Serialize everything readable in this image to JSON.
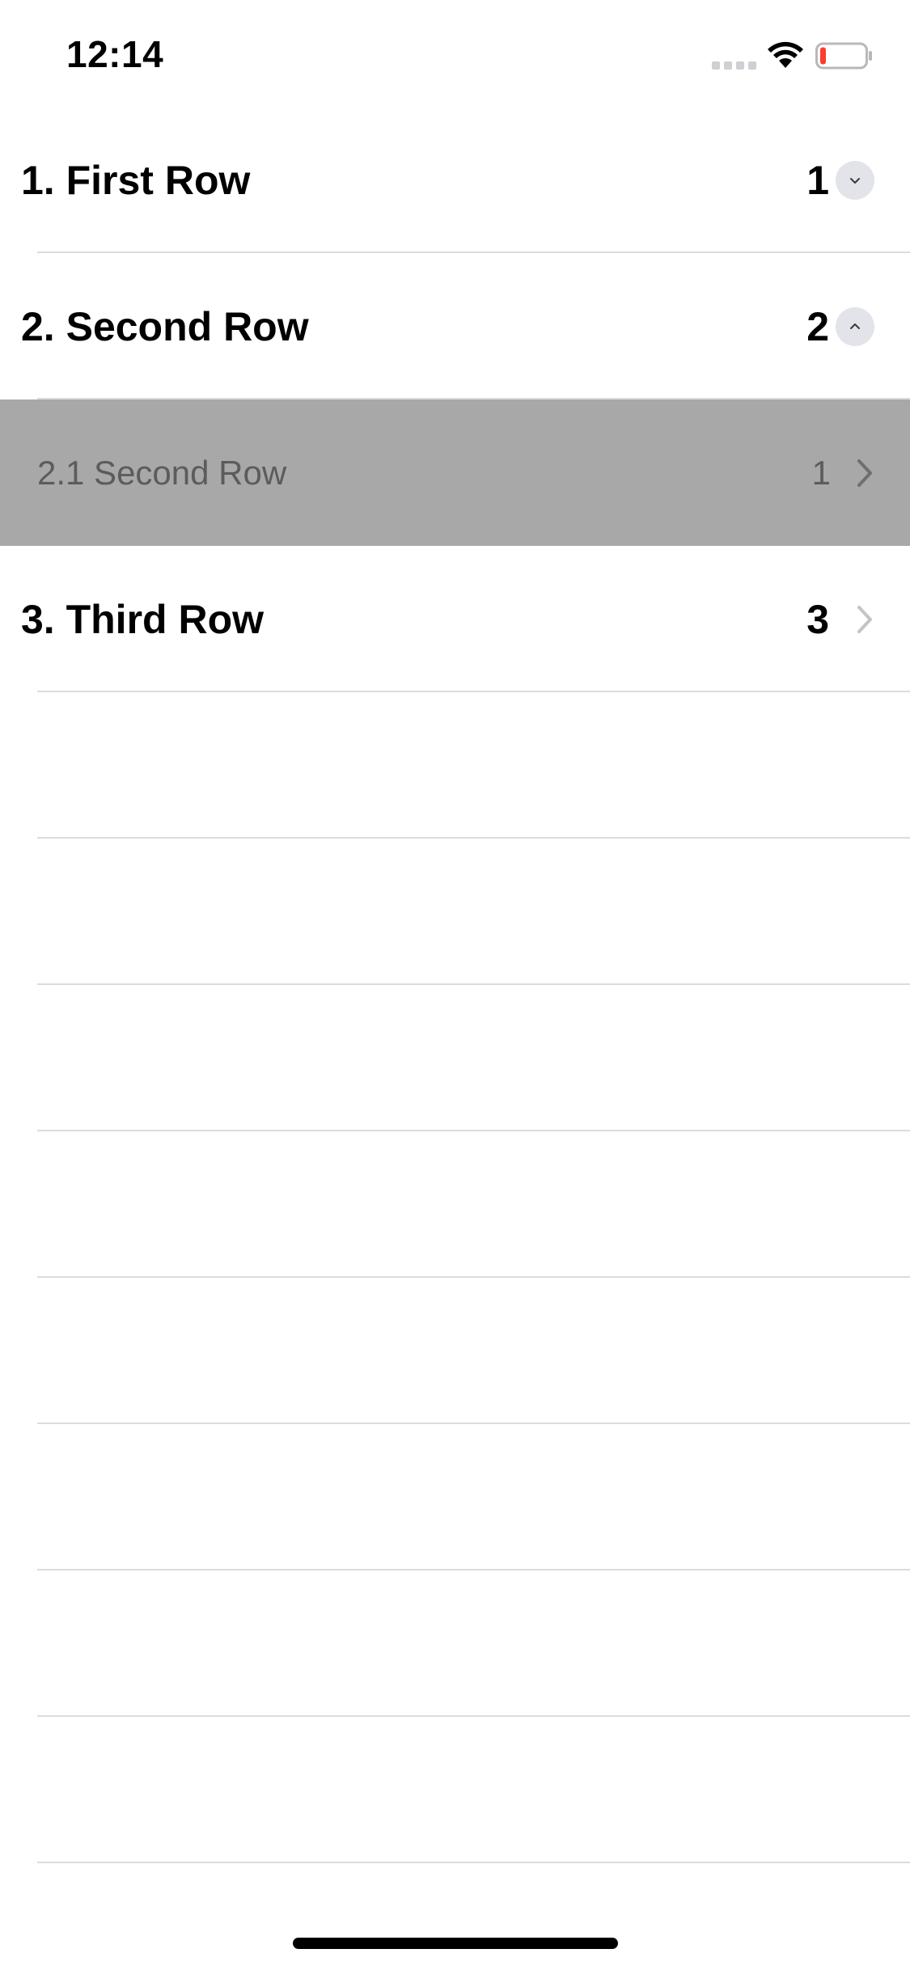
{
  "status_bar": {
    "time": "12:14"
  },
  "rows": [
    {
      "title": "1. First Row",
      "count": "1",
      "accessory": "chevron-down-circle"
    },
    {
      "title": "2. Second Row",
      "count": "2",
      "accessory": "chevron-up-circle"
    },
    {
      "title": "2.1 Second Row",
      "count": "1",
      "accessory": "chevron-right",
      "highlighted": true
    },
    {
      "title": "3. Third Row",
      "count": "3",
      "accessory": "chevron-right"
    }
  ],
  "colors": {
    "highlight_row_background": "#a8a8a8",
    "separator": "#dcdcdf",
    "disclosure_circle": "#e3e3ea",
    "battery_low": "#ff3b30"
  },
  "battery_level_percent": 10
}
